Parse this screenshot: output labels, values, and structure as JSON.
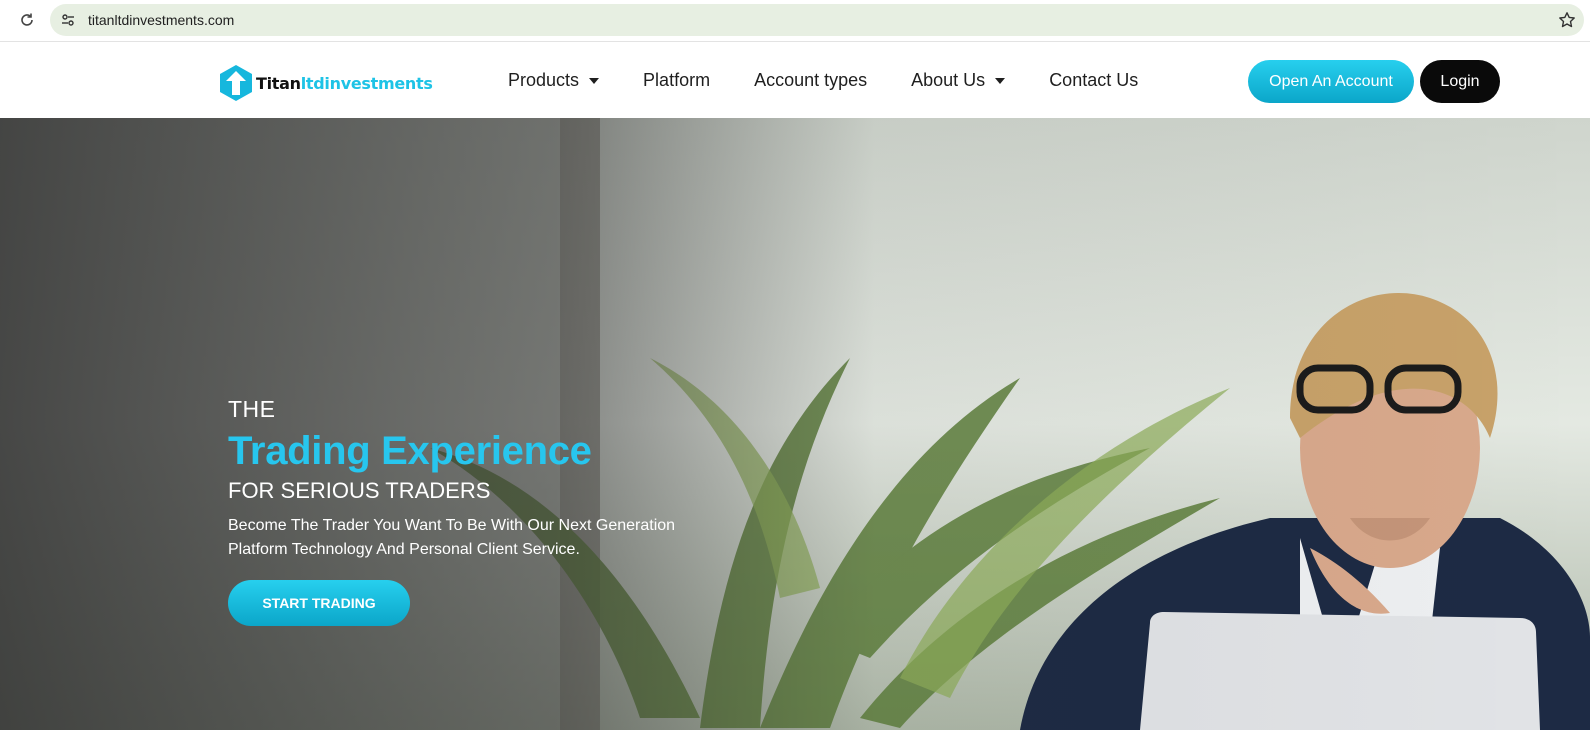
{
  "browser": {
    "url": "titanltdinvestments.com",
    "icons": {
      "reload": "reload-icon",
      "site_info": "site-info-icon",
      "bookmark": "star-icon"
    }
  },
  "header": {
    "logo": {
      "part1": "Titan",
      "part2": "ltdinvestments",
      "mark": "titan-logo-mark"
    },
    "nav": [
      {
        "label": "Products",
        "dropdown": true
      },
      {
        "label": "Platform",
        "dropdown": false
      },
      {
        "label": "Account types",
        "dropdown": false
      },
      {
        "label": "About Us",
        "dropdown": true
      },
      {
        "label": "Contact Us",
        "dropdown": false
      }
    ],
    "open_account_label": "Open An Account",
    "login_label": "Login"
  },
  "hero": {
    "line1": "THE",
    "title": "Trading Experience",
    "line3": "FOR SERIOUS TRADERS",
    "description": "Become The Trader You Want To Be With Our Next Generation Platform Technology And Personal Client Service.",
    "cta_label": "START TRADING"
  },
  "colors": {
    "accent": "#1ec3e6",
    "button_dark": "#0a0a0a",
    "omnibox": "#e7efe2"
  }
}
